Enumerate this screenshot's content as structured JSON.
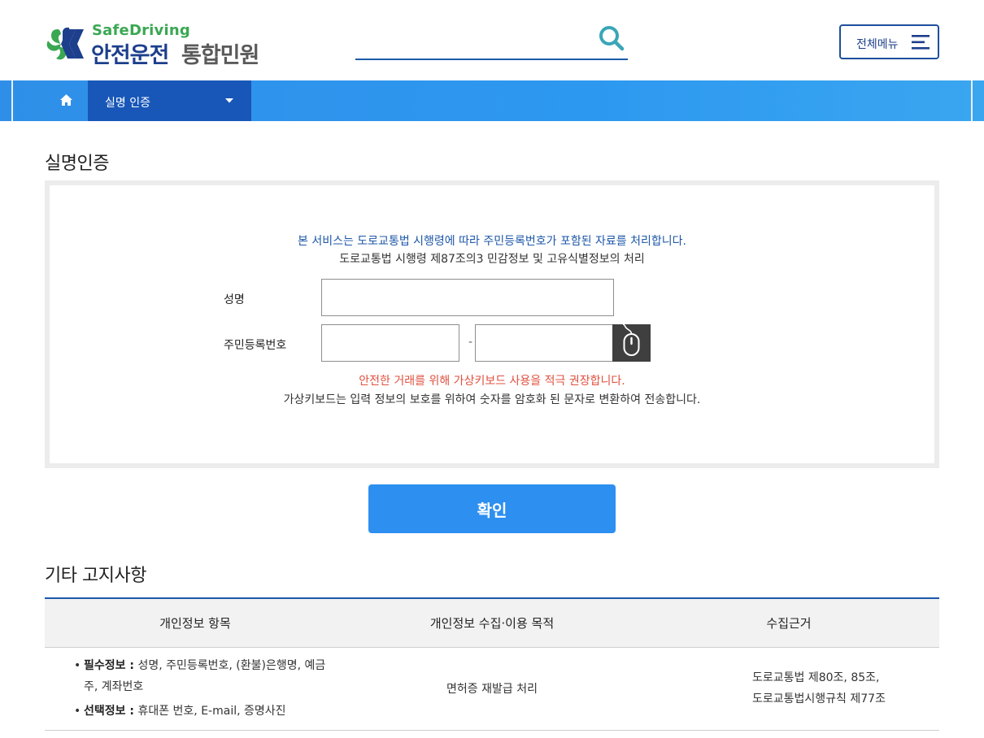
{
  "header": {
    "logo_en": "SafeDriving",
    "logo_ko_main": "안전운전",
    "logo_ko_sub": "통합민원",
    "search": {
      "value": "",
      "placeholder": ""
    },
    "all_menu_label": "전체메뉴"
  },
  "nav": {
    "home_icon": "home-icon",
    "dropdown_label": "실명 인증"
  },
  "auth": {
    "title": "실명인증",
    "notice_blue": "본 서비스는 도로교통법 시행령에 따라 주민등록번호가 포함된 자료를 처리합니다.",
    "notice_dark": "도로교통법 시행령 제87조의3 민감정보 및 고유식별정보의 처리",
    "name_label": "성명",
    "rrn_label": "주민등록번호",
    "rrn_separator": "-",
    "warn_red": "안전한 거래를 위해 가상키보드 사용을 적극 권장합니다.",
    "warn_dark": "가상키보드는 입력 정보의 보호를 위하여 숫자를 암호화 된 문자로 변환하여 전송합니다.",
    "confirm_label": "확인"
  },
  "notice": {
    "title": "기타 고지사항",
    "headers": [
      "개인정보 항목",
      "개인정보 수집·이용 목적",
      "수집근거"
    ],
    "required_label": "필수정보 :",
    "required_value": " 성명, 주민등록번호, (환불)은행명, 예금주, 계좌번호",
    "optional_label": "선택정보 :",
    "optional_value": " 휴대폰 번호, E-mail, 증명사진",
    "purpose": "면허증 재발급 처리",
    "basis_line1": "도로교통법 제80조, 85조,",
    "basis_line2": "도로교통법시행규칙 제77조"
  },
  "colors": {
    "brand_navy": "#1d3f8c",
    "brand_green": "#3aa853",
    "nav_blue": "#2d8ff0",
    "nav_dark": "#1857b8",
    "warn_red": "#e0503f"
  }
}
